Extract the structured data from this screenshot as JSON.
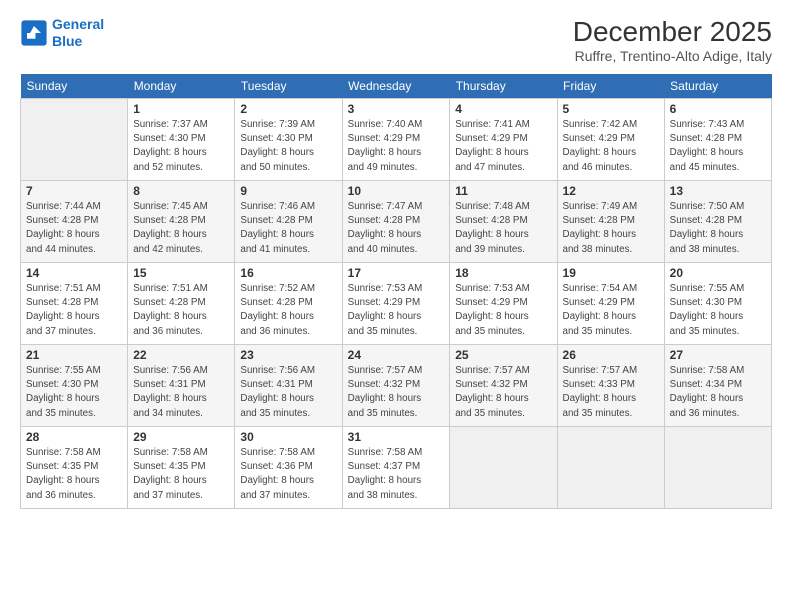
{
  "header": {
    "logo_line1": "General",
    "logo_line2": "Blue",
    "month_title": "December 2025",
    "location": "Ruffre, Trentino-Alto Adige, Italy"
  },
  "weekdays": [
    "Sunday",
    "Monday",
    "Tuesday",
    "Wednesday",
    "Thursday",
    "Friday",
    "Saturday"
  ],
  "weeks": [
    [
      {
        "day": "",
        "info": ""
      },
      {
        "day": "1",
        "info": "Sunrise: 7:37 AM\nSunset: 4:30 PM\nDaylight: 8 hours\nand 52 minutes."
      },
      {
        "day": "2",
        "info": "Sunrise: 7:39 AM\nSunset: 4:30 PM\nDaylight: 8 hours\nand 50 minutes."
      },
      {
        "day": "3",
        "info": "Sunrise: 7:40 AM\nSunset: 4:29 PM\nDaylight: 8 hours\nand 49 minutes."
      },
      {
        "day": "4",
        "info": "Sunrise: 7:41 AM\nSunset: 4:29 PM\nDaylight: 8 hours\nand 47 minutes."
      },
      {
        "day": "5",
        "info": "Sunrise: 7:42 AM\nSunset: 4:29 PM\nDaylight: 8 hours\nand 46 minutes."
      },
      {
        "day": "6",
        "info": "Sunrise: 7:43 AM\nSunset: 4:28 PM\nDaylight: 8 hours\nand 45 minutes."
      }
    ],
    [
      {
        "day": "7",
        "info": "Sunrise: 7:44 AM\nSunset: 4:28 PM\nDaylight: 8 hours\nand 44 minutes."
      },
      {
        "day": "8",
        "info": "Sunrise: 7:45 AM\nSunset: 4:28 PM\nDaylight: 8 hours\nand 42 minutes."
      },
      {
        "day": "9",
        "info": "Sunrise: 7:46 AM\nSunset: 4:28 PM\nDaylight: 8 hours\nand 41 minutes."
      },
      {
        "day": "10",
        "info": "Sunrise: 7:47 AM\nSunset: 4:28 PM\nDaylight: 8 hours\nand 40 minutes."
      },
      {
        "day": "11",
        "info": "Sunrise: 7:48 AM\nSunset: 4:28 PM\nDaylight: 8 hours\nand 39 minutes."
      },
      {
        "day": "12",
        "info": "Sunrise: 7:49 AM\nSunset: 4:28 PM\nDaylight: 8 hours\nand 38 minutes."
      },
      {
        "day": "13",
        "info": "Sunrise: 7:50 AM\nSunset: 4:28 PM\nDaylight: 8 hours\nand 38 minutes."
      }
    ],
    [
      {
        "day": "14",
        "info": "Sunrise: 7:51 AM\nSunset: 4:28 PM\nDaylight: 8 hours\nand 37 minutes."
      },
      {
        "day": "15",
        "info": "Sunrise: 7:51 AM\nSunset: 4:28 PM\nDaylight: 8 hours\nand 36 minutes."
      },
      {
        "day": "16",
        "info": "Sunrise: 7:52 AM\nSunset: 4:28 PM\nDaylight: 8 hours\nand 36 minutes."
      },
      {
        "day": "17",
        "info": "Sunrise: 7:53 AM\nSunset: 4:29 PM\nDaylight: 8 hours\nand 35 minutes."
      },
      {
        "day": "18",
        "info": "Sunrise: 7:53 AM\nSunset: 4:29 PM\nDaylight: 8 hours\nand 35 minutes."
      },
      {
        "day": "19",
        "info": "Sunrise: 7:54 AM\nSunset: 4:29 PM\nDaylight: 8 hours\nand 35 minutes."
      },
      {
        "day": "20",
        "info": "Sunrise: 7:55 AM\nSunset: 4:30 PM\nDaylight: 8 hours\nand 35 minutes."
      }
    ],
    [
      {
        "day": "21",
        "info": "Sunrise: 7:55 AM\nSunset: 4:30 PM\nDaylight: 8 hours\nand 35 minutes."
      },
      {
        "day": "22",
        "info": "Sunrise: 7:56 AM\nSunset: 4:31 PM\nDaylight: 8 hours\nand 34 minutes."
      },
      {
        "day": "23",
        "info": "Sunrise: 7:56 AM\nSunset: 4:31 PM\nDaylight: 8 hours\nand 35 minutes."
      },
      {
        "day": "24",
        "info": "Sunrise: 7:57 AM\nSunset: 4:32 PM\nDaylight: 8 hours\nand 35 minutes."
      },
      {
        "day": "25",
        "info": "Sunrise: 7:57 AM\nSunset: 4:32 PM\nDaylight: 8 hours\nand 35 minutes."
      },
      {
        "day": "26",
        "info": "Sunrise: 7:57 AM\nSunset: 4:33 PM\nDaylight: 8 hours\nand 35 minutes."
      },
      {
        "day": "27",
        "info": "Sunrise: 7:58 AM\nSunset: 4:34 PM\nDaylight: 8 hours\nand 36 minutes."
      }
    ],
    [
      {
        "day": "28",
        "info": "Sunrise: 7:58 AM\nSunset: 4:35 PM\nDaylight: 8 hours\nand 36 minutes."
      },
      {
        "day": "29",
        "info": "Sunrise: 7:58 AM\nSunset: 4:35 PM\nDaylight: 8 hours\nand 37 minutes."
      },
      {
        "day": "30",
        "info": "Sunrise: 7:58 AM\nSunset: 4:36 PM\nDaylight: 8 hours\nand 37 minutes."
      },
      {
        "day": "31",
        "info": "Sunrise: 7:58 AM\nSunset: 4:37 PM\nDaylight: 8 hours\nand 38 minutes."
      },
      {
        "day": "",
        "info": ""
      },
      {
        "day": "",
        "info": ""
      },
      {
        "day": "",
        "info": ""
      }
    ]
  ]
}
